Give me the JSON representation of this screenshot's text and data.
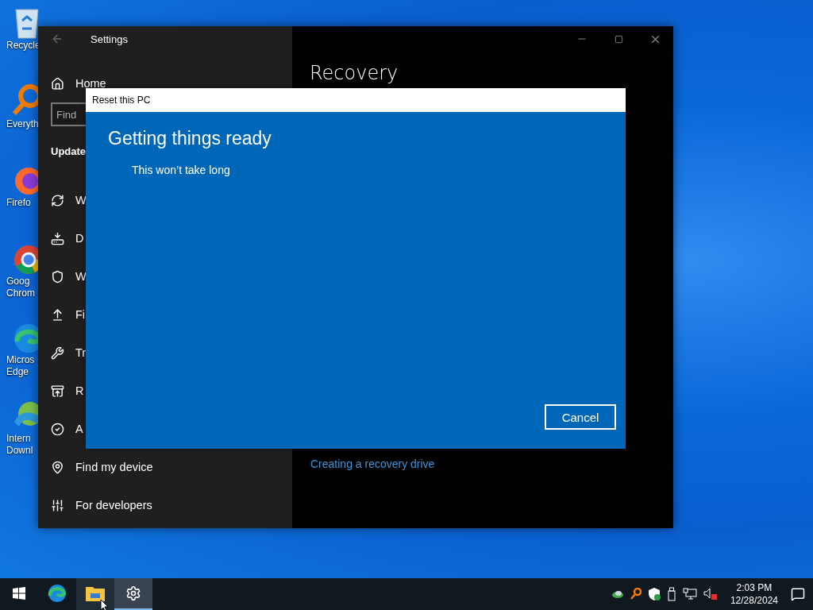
{
  "desktop_icons": [
    {
      "kind": "bin",
      "lines": [
        "Recycle"
      ]
    },
    {
      "kind": "magnifier",
      "lines": [
        "Everyth"
      ]
    },
    {
      "kind": "fox",
      "lines": [
        "Firefo"
      ]
    },
    {
      "kind": "globe",
      "lines": [
        "Goog",
        "Chrom"
      ]
    },
    {
      "kind": "wave",
      "lines": [
        "Micros",
        "Edge"
      ]
    },
    {
      "kind": "download",
      "lines": [
        "Intern",
        "Downl"
      ]
    }
  ],
  "settings_window": {
    "title": "Settings",
    "sidebar": {
      "home": "Home",
      "search": {
        "placeholder": "Find"
      },
      "section": "Update",
      "items": [
        {
          "kind": "sync",
          "label": "W"
        },
        {
          "kind": "delivery",
          "label": "D"
        },
        {
          "kind": "shield",
          "label": "W"
        },
        {
          "kind": "backup",
          "label": "Fi"
        },
        {
          "kind": "wrench",
          "label": "Tr"
        },
        {
          "kind": "recovery",
          "label": "R"
        },
        {
          "kind": "check",
          "label": "A"
        },
        {
          "kind": "device",
          "label": "Find my device"
        },
        {
          "kind": "developer",
          "label": "For developers"
        }
      ]
    },
    "content": {
      "heading": "Recovery",
      "link": "Creating a recovery drive"
    }
  },
  "dialog": {
    "title": "Reset this PC",
    "heading": "Getting things ready",
    "message": "This won’t take long",
    "button": "Cancel"
  },
  "taskbar": {
    "apps": [
      {
        "kind": "start",
        "active": false,
        "hovered": false
      },
      {
        "kind": "browser",
        "active": false,
        "hovered": false
      },
      {
        "kind": "folder",
        "active": false,
        "hovered": true
      },
      {
        "kind": "settings",
        "active": true,
        "hovered": false
      }
    ],
    "tray": [
      {
        "kind": "cloud"
      },
      {
        "kind": "magnifier"
      },
      {
        "kind": "shield"
      },
      {
        "kind": "usb"
      },
      {
        "kind": "network"
      },
      {
        "kind": "speaker"
      }
    ],
    "time": "2:03 PM",
    "date": "12/28/2024"
  }
}
